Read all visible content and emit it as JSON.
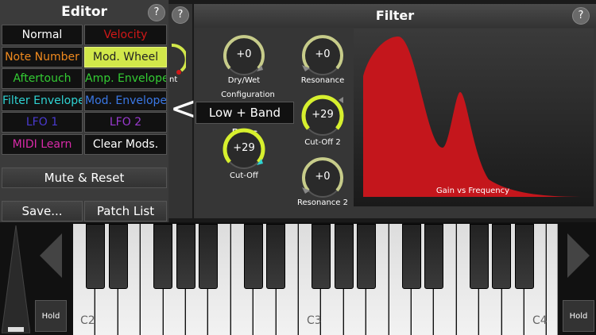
{
  "editor": {
    "title": "Editor",
    "help": "?",
    "buttons": [
      {
        "label": "Normal",
        "color": "#ffffff"
      },
      {
        "label": "Velocity",
        "color": "#d01818"
      },
      {
        "label": "Note Number",
        "color": "#f08a1e"
      },
      {
        "label": "Mod. Wheel",
        "color": "#222222"
      },
      {
        "label": "Aftertouch",
        "color": "#33cc33"
      },
      {
        "label": "Amp. Envelope",
        "color": "#33cc33"
      },
      {
        "label": "Filter Envelope",
        "color": "#2fd3d3"
      },
      {
        "label": "Mod. Envelope",
        "color": "#3a78e6"
      },
      {
        "label": "LFO 1",
        "color": "#4a3ad0"
      },
      {
        "label": "LFO 2",
        "color": "#9a3ad0"
      },
      {
        "label": "MIDI Learn",
        "color": "#d82aa8"
      },
      {
        "label": "Clear Mods.",
        "color": "#ffffff"
      }
    ],
    "mute_reset": "Mute & Reset",
    "save": "Save...",
    "patch_list": "Patch List"
  },
  "behind_panel": {
    "help": "?",
    "partial_label": "nt"
  },
  "back_chevron": "<",
  "filter": {
    "title": "Filter",
    "help": "?",
    "knobs": {
      "dry_wet": {
        "value": "+0",
        "label": "Dry/Wet"
      },
      "resonance": {
        "value": "+0",
        "label": "Resonance"
      },
      "cutoff": {
        "value": "+29",
        "label": "Cut-Off"
      },
      "cutoff2": {
        "value": "+29",
        "label": "Cut-Off 2"
      },
      "resonance2": {
        "value": "+0",
        "label": "Resonance 2"
      }
    },
    "configuration_label": "Configuration",
    "configuration_value": "Low + Band Pass",
    "graph_caption": "Gain vs Frequency",
    "graph_color": "#c4161c"
  },
  "keyboard": {
    "labels": [
      "C2",
      "C3",
      "C4"
    ],
    "hold_left": "Hold",
    "hold_right": "Hold"
  }
}
